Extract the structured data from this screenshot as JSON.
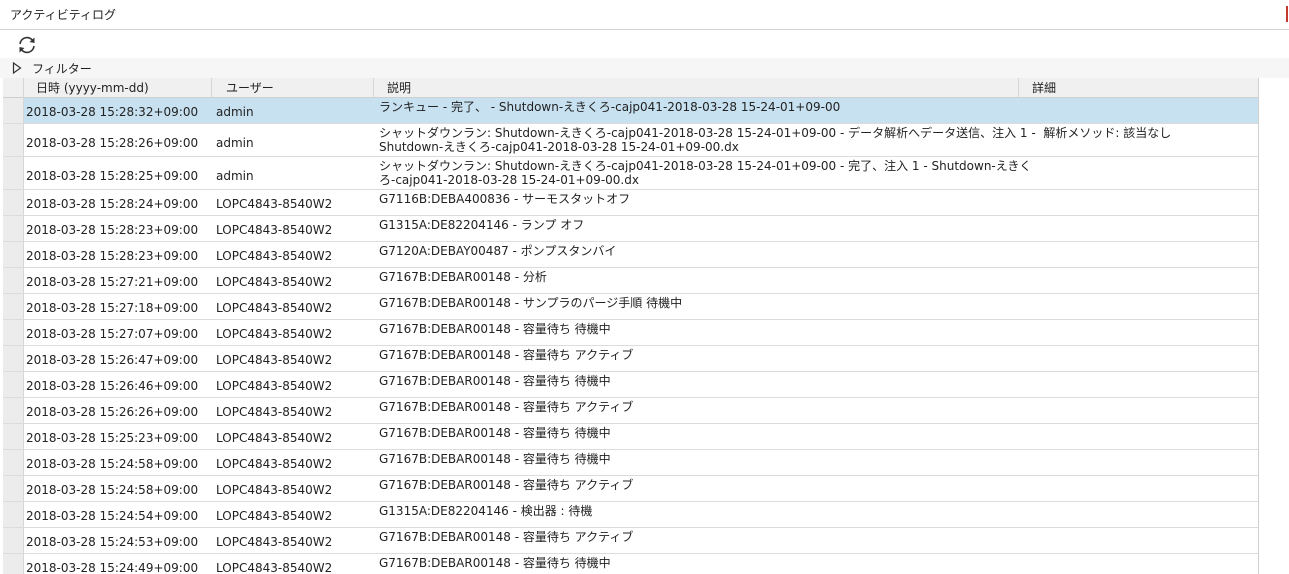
{
  "window": {
    "title": "アクティビティログ",
    "accent_color": "#c0392b"
  },
  "toolbar": {
    "refresh_icon": "refresh-icon"
  },
  "filter": {
    "label": "フィルター",
    "expanded": false
  },
  "table": {
    "columns": [
      "日時 (yyyy-mm-dd)",
      "ユーザー",
      "説明",
      "詳細"
    ],
    "selected_row_color": "#c8e1f1",
    "rows": [
      {
        "date": "2018-03-28 15:28:32+09:00",
        "user": "admin",
        "desc": "ランキュー - 完了、 - Shutdown-えきくろ-cajp041-2018-03-28 15-24-01+09-00",
        "detail": "",
        "selected": true,
        "tall": false
      },
      {
        "date": "2018-03-28 15:28:26+09:00",
        "user": "admin",
        "desc": "シャットダウンラン: Shutdown-えきくろ-cajp041-2018-03-28 15-24-01+09-00 - データ解析へデータ送信、注入 1 -  解析メソッド: 該当なし\nShutdown-えきくろ-cajp041-2018-03-28 15-24-01+09-00.dx",
        "detail": "",
        "selected": false,
        "tall": true
      },
      {
        "date": "2018-03-28 15:28:25+09:00",
        "user": "admin",
        "desc": "シャットダウンラン: Shutdown-えきくろ-cajp041-2018-03-28 15-24-01+09-00 - 完了、注入 1 - Shutdown-えきく\nろ-cajp041-2018-03-28 15-24-01+09-00.dx",
        "detail": "",
        "selected": false,
        "tall": true
      },
      {
        "date": "2018-03-28 15:28:24+09:00",
        "user": "LOPC4843-8540W2",
        "desc": "G7116B:DEBA400836 - サーモスタットオフ",
        "detail": "",
        "selected": false,
        "tall": false
      },
      {
        "date": "2018-03-28 15:28:23+09:00",
        "user": "LOPC4843-8540W2",
        "desc": "G1315A:DE82204146 - ランプ オフ",
        "detail": "",
        "selected": false,
        "tall": false
      },
      {
        "date": "2018-03-28 15:28:23+09:00",
        "user": "LOPC4843-8540W2",
        "desc": "G7120A:DEBAY00487 - ポンプスタンバイ",
        "detail": "",
        "selected": false,
        "tall": false
      },
      {
        "date": "2018-03-28 15:27:21+09:00",
        "user": "LOPC4843-8540W2",
        "desc": "G7167B:DEBAR00148 - 分析",
        "detail": "",
        "selected": false,
        "tall": false
      },
      {
        "date": "2018-03-28 15:27:18+09:00",
        "user": "LOPC4843-8540W2",
        "desc": "G7167B:DEBAR00148 - サンプラのパージ手順 待機中",
        "detail": "",
        "selected": false,
        "tall": false
      },
      {
        "date": "2018-03-28 15:27:07+09:00",
        "user": "LOPC4843-8540W2",
        "desc": "G7167B:DEBAR00148 - 容量待ち 待機中",
        "detail": "",
        "selected": false,
        "tall": false
      },
      {
        "date": "2018-03-28 15:26:47+09:00",
        "user": "LOPC4843-8540W2",
        "desc": "G7167B:DEBAR00148 - 容量待ち アクティブ",
        "detail": "",
        "selected": false,
        "tall": false
      },
      {
        "date": "2018-03-28 15:26:46+09:00",
        "user": "LOPC4843-8540W2",
        "desc": "G7167B:DEBAR00148 - 容量待ち 待機中",
        "detail": "",
        "selected": false,
        "tall": false
      },
      {
        "date": "2018-03-28 15:26:26+09:00",
        "user": "LOPC4843-8540W2",
        "desc": "G7167B:DEBAR00148 - 容量待ち アクティブ",
        "detail": "",
        "selected": false,
        "tall": false
      },
      {
        "date": "2018-03-28 15:25:23+09:00",
        "user": "LOPC4843-8540W2",
        "desc": "G7167B:DEBAR00148 - 容量待ち 待機中",
        "detail": "",
        "selected": false,
        "tall": false
      },
      {
        "date": "2018-03-28 15:24:58+09:00",
        "user": "LOPC4843-8540W2",
        "desc": "G7167B:DEBAR00148 - 容量待ち 待機中",
        "detail": "",
        "selected": false,
        "tall": false
      },
      {
        "date": "2018-03-28 15:24:58+09:00",
        "user": "LOPC4843-8540W2",
        "desc": "G7167B:DEBAR00148 - 容量待ち アクティブ",
        "detail": "",
        "selected": false,
        "tall": false
      },
      {
        "date": "2018-03-28 15:24:54+09:00",
        "user": "LOPC4843-8540W2",
        "desc": "G1315A:DE82204146 - 検出器 : 待機",
        "detail": "",
        "selected": false,
        "tall": false
      },
      {
        "date": "2018-03-28 15:24:53+09:00",
        "user": "LOPC4843-8540W2",
        "desc": "G7167B:DEBAR00148 - 容量待ち アクティブ",
        "detail": "",
        "selected": false,
        "tall": false
      },
      {
        "date": "2018-03-28 15:24:49+09:00",
        "user": "LOPC4843-8540W2",
        "desc": "G7167B:DEBAR00148 - 容量待ち 待機中",
        "detail": "",
        "selected": false,
        "tall": false
      }
    ]
  }
}
